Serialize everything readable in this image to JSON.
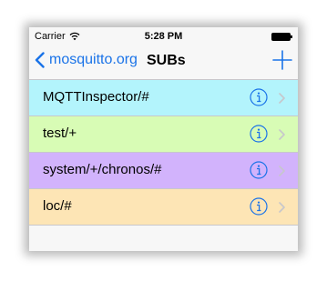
{
  "status_bar": {
    "carrier": "Carrier",
    "time": "5:28 PM"
  },
  "nav": {
    "back_label": "mosquitto.org",
    "title": "SUBs"
  },
  "colors": {
    "accent": "#1a73e8",
    "row_backgrounds": [
      "#b3f4fc",
      "#d8fcb5",
      "#d2b3fc",
      "#fde5b5"
    ]
  },
  "subscriptions": [
    {
      "topic": "MQTTInspector/#",
      "color": "#b3f4fc"
    },
    {
      "topic": "test/+",
      "color": "#d8fcb5"
    },
    {
      "topic": "system/+/chronos/#",
      "color": "#d2b3fc"
    },
    {
      "topic": "loc/#",
      "color": "#fde5b5"
    }
  ]
}
